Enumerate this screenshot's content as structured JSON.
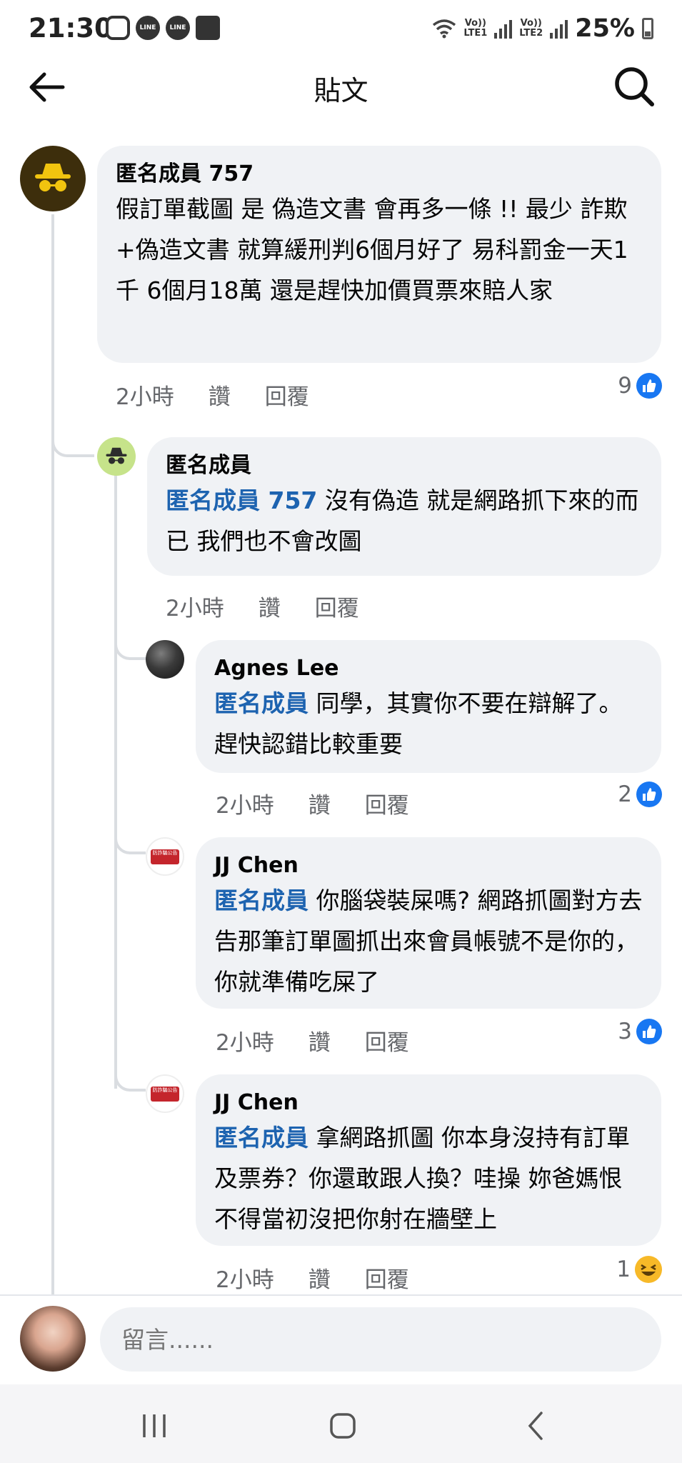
{
  "status_bar": {
    "time": "21:30",
    "network1": [
      "Vo))",
      "LTE1"
    ],
    "network2": [
      "Vo))",
      "LTE2"
    ],
    "battery": "25%",
    "app_icons": [
      "instagram-icon",
      "line-icon",
      "line-icon",
      "gallery-icon"
    ],
    "line_label": "LINE"
  },
  "app_bar": {
    "title": "貼文"
  },
  "comments": [
    {
      "name": "匿名成員 757",
      "text": "假訂單截圖 是 偽造文書 會再多一條 !! 最少 詐欺+偽造文書 就算緩刑判6個月好了 易科罰金一天1千 6個月18萬  還是趕快加價買票來賠人家",
      "time": "2小時",
      "like": "讚",
      "reply": "回覆",
      "reaction_count": "9",
      "reaction": "like"
    },
    {
      "name": "匿名成員",
      "mention": "匿名成員 757",
      "text": " 沒有偽造 就是網路抓下來的而已 我們也不會改圖",
      "time": "2小時",
      "like": "讚",
      "reply": "回覆"
    },
    {
      "name": "Agnes Lee",
      "mention": "匿名成員",
      "text": " 同學，其實你不要在辯解了。趕快認錯比較重要",
      "time": "2小時",
      "like": "讚",
      "reply": "回覆",
      "reaction_count": "2",
      "reaction": "like"
    },
    {
      "name": "JJ Chen",
      "mention": "匿名成員",
      "text": " 你腦袋裝屎嗎? 網路抓圖對方去告那筆訂單圖抓出來會員帳號不是你的，你就準備吃屎了",
      "time": "2小時",
      "like": "讚",
      "reply": "回覆",
      "reaction_count": "3",
      "reaction": "like"
    },
    {
      "name": "JJ Chen",
      "mention": "匿名成員",
      "text": " 拿網路抓圖 你本身沒持有訂單及票券？你還敢跟人換？哇操 妳爸媽恨不得當初沒把你射在牆壁上",
      "time": "2小時",
      "like": "讚",
      "reply": "回覆",
      "reaction_count": "1",
      "reaction": "haha"
    }
  ],
  "badge_text": "防詐騙公告",
  "composer": {
    "placeholder": "留言......"
  },
  "colors": {
    "mention": "#1d63b0",
    "like": "#1877f2",
    "bubble": "#f0f2f5",
    "meta": "#65676b"
  }
}
